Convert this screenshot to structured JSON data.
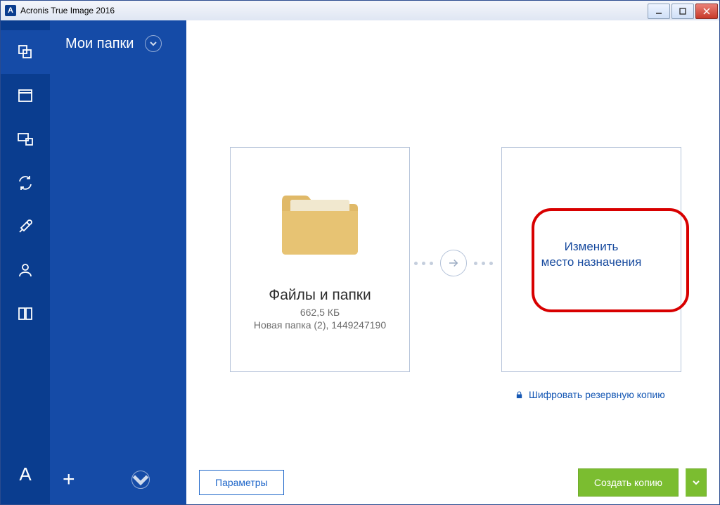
{
  "window": {
    "title": "Acronis True Image 2016",
    "app_glyph": "A"
  },
  "sidebar": {
    "header": "Мои папки"
  },
  "source_card": {
    "title": "Файлы и папки",
    "size": "662,5 КБ",
    "subtitle": "Новая папка (2), 1449247190"
  },
  "dest_card": {
    "line1": "Изменить",
    "line2": "место назначения"
  },
  "encrypt_label": "Шифровать резервную копию",
  "buttons": {
    "params": "Параметры",
    "create": "Создать копию"
  }
}
